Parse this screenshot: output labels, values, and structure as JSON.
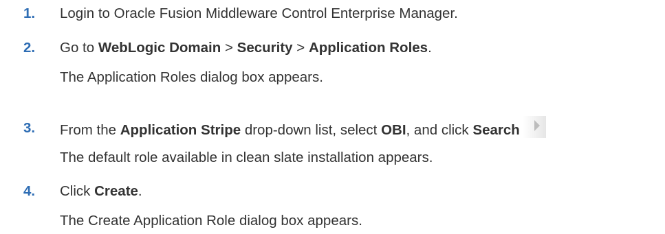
{
  "steps": [
    {
      "number": "1.",
      "text": "Login to Oracle Fusion Middleware Control Enterprise Manager."
    },
    {
      "number": "2.",
      "prefix": "Go to ",
      "b1": "WebLogic Domain",
      "sep1": " > ",
      "b2": "Security",
      "sep2": " > ",
      "b3": "Application Roles",
      "suffix": ".",
      "result": "The Application Roles dialog box appears."
    },
    {
      "number": "3.",
      "prefix": "From the ",
      "b1": "Application Stripe",
      "mid1": " drop-down list, select ",
      "b2": "OBI",
      "mid2": ", and click ",
      "b3": "Search",
      "icon": "search-arrow-icon",
      "result": "The default role available in clean slate installation appears."
    },
    {
      "number": "4.",
      "prefix": "Click ",
      "b1": "Create",
      "suffix": ".",
      "result": "The Create Application Role dialog box appears."
    }
  ],
  "colors": {
    "step_number": "#2e6db4",
    "text": "#333333",
    "icon": "#bdbdbd"
  }
}
